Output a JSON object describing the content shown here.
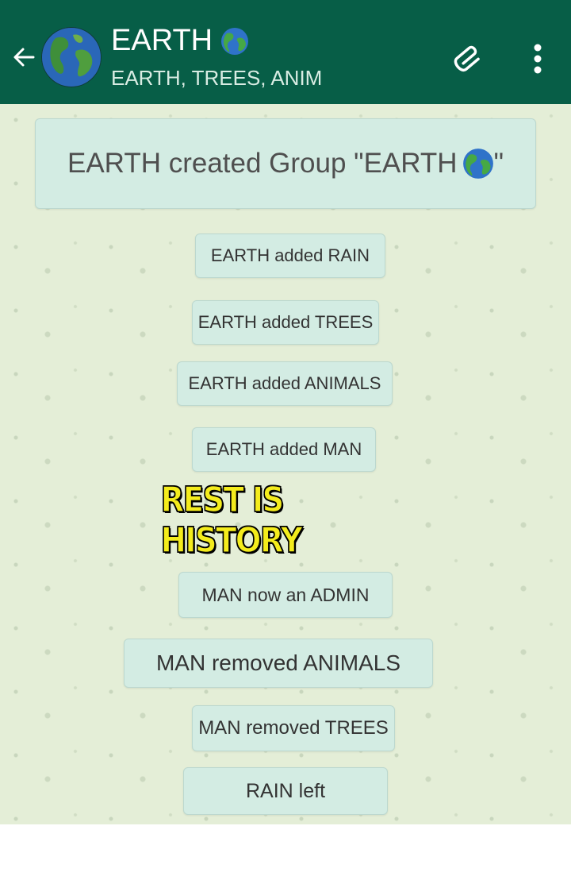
{
  "header": {
    "title": "EARTH",
    "subtitle": "EARTH, TREES, ANIM",
    "background_color": "#075e47",
    "icons": {
      "back": "back-arrow-icon",
      "avatar": "globe-avatar",
      "attach": "paperclip-icon",
      "menu": "more-vertical-icon"
    }
  },
  "chat": {
    "background_color": "#e4eed7",
    "bubble_color": "#d3ece3",
    "group_created": "EARTH created Group \"EARTH",
    "group_created_end": "\"",
    "messages": [
      "EARTH added RAIN",
      "EARTH added TREES",
      "EARTH added ANIMALS",
      "EARTH added MAN"
    ],
    "overlay_caption": "REST IS HISTORY",
    "after_messages": [
      "MAN now an ADMIN",
      "MAN removed ANIMALS",
      "MAN removed TREES",
      "RAIN left"
    ]
  }
}
